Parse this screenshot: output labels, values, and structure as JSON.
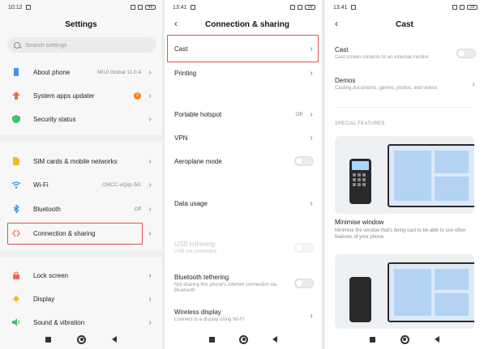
{
  "status": {
    "time1": "10:12",
    "time2": "13:41",
    "time3": "13:41",
    "battery1": "46",
    "battery2": "28",
    "battery3": "28"
  },
  "settings": {
    "title": "Settings",
    "search_placeholder": "Search settings",
    "items": [
      {
        "label": "About phone",
        "value": "MIUI Global 11.0.4",
        "icon": "phone-icon",
        "color": "#4a90e2"
      },
      {
        "label": "System apps updater",
        "badge": "2",
        "icon": "arrow-up-icon",
        "color": "#f06a4a"
      },
      {
        "label": "Security status",
        "icon": "shield-icon",
        "color": "#3cc36d"
      },
      {
        "label": "SIM cards & mobile networks",
        "icon": "sim-card-icon",
        "color": "#f5b623"
      },
      {
        "label": "Wi-Fi",
        "value": "CMCC-uQqc-5G",
        "icon": "wifi-icon",
        "color": "#2f8de4"
      },
      {
        "label": "Bluetooth",
        "value": "Off",
        "icon": "bluetooth-icon",
        "color": "#2f8de4"
      },
      {
        "label": "Connection & sharing",
        "icon": "connection-icon",
        "color": "#f0764a"
      },
      {
        "label": "Lock screen",
        "icon": "lock-icon",
        "color": "#f06a4a"
      },
      {
        "label": "Display",
        "icon": "sun-icon",
        "color": "#f5b623"
      },
      {
        "label": "Sound & vibration",
        "icon": "speaker-icon",
        "color": "#3cc36d"
      }
    ]
  },
  "connection": {
    "title": "Connection & sharing",
    "items": [
      {
        "label": "Cast"
      },
      {
        "label": "Printing"
      },
      {
        "label": "Portable hotspot",
        "value": "Off"
      },
      {
        "label": "VPN"
      },
      {
        "label": "Aeroplane mode"
      },
      {
        "label": "Data usage"
      },
      {
        "label": "USB tethering",
        "sub": "USB not connected"
      },
      {
        "label": "Bluetooth tethering",
        "sub": "Not sharing this phone's Internet connection via Bluetooth"
      },
      {
        "label": "Wireless display",
        "sub": "Connect to a display using Wi-Fi"
      }
    ]
  },
  "cast": {
    "title": "Cast",
    "cast_label": "Cast",
    "cast_sub": "Cast screen contents to an external monitor",
    "demos_label": "Demos",
    "demos_sub": "Casting documents, games, photos, and videos",
    "section": "SPECIAL FEATURES",
    "feature_title": "Minimise window",
    "feature_desc": "Minimise the window that's being cast to be able to use other features of your phone."
  },
  "colors": {
    "accent": "#e0524e",
    "badge": "#f58220"
  }
}
